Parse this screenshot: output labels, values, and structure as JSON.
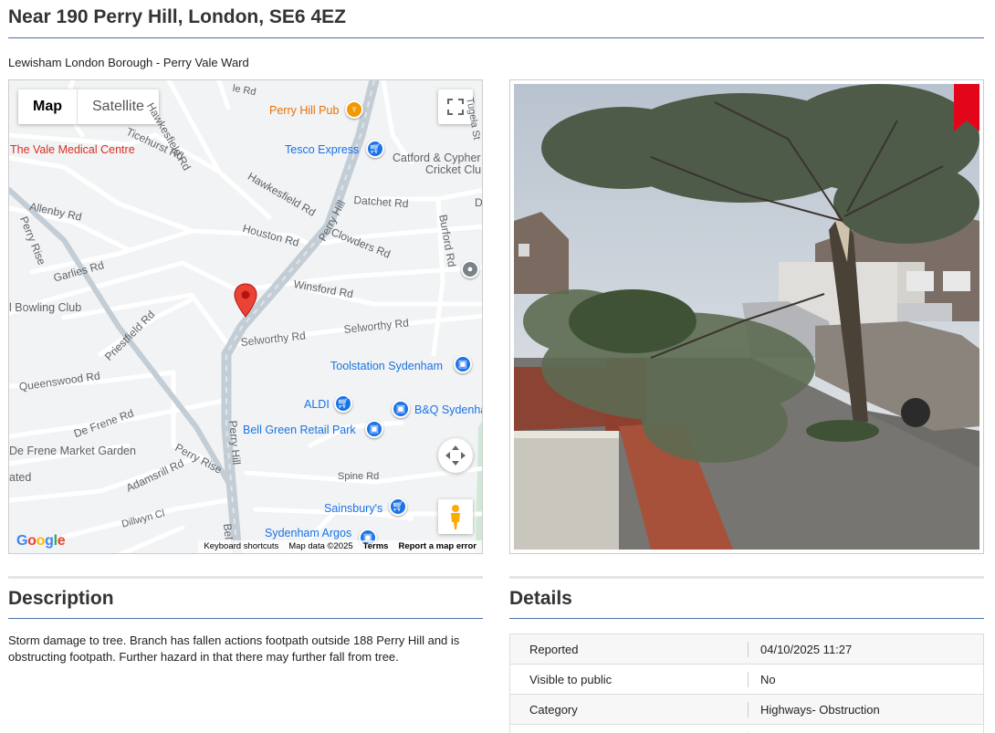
{
  "page": {
    "title": "Near 190 Perry Hill, London, SE6 4EZ",
    "ward": "Lewisham London Borough - Perry Vale Ward"
  },
  "map": {
    "type_map_label": "Map",
    "type_satellite_label": "Satellite",
    "streets": {
      "hawkesfield_top": "Hawkesfield Rd",
      "ticehurst": "Ticehurst Rd",
      "hawkesfield_mid": "Hawkesfield Rd",
      "allenby": "Allenby Rd",
      "perry_rise_left": "Perry Rise",
      "garlies": "Garlies Rd",
      "houston": "Houston Rd",
      "perry_hill_diag": "Perry Hill",
      "clowders": "Clowders Rd",
      "datchet": "Datchet Rd",
      "burford": "Burford Rd",
      "winsford": "Winsford Rd",
      "selworthy_left": "Selworthy Rd",
      "selworthy_right": "Selworthy Rd",
      "priestfield": "Priestfield Rd",
      "queenswood": "Queenswood Rd",
      "de_frene": "De Frene Rd",
      "perry_rise_bottom": "Perry Rise",
      "adamsrill": "Adamsrill Rd",
      "perry_hill_vert": "Perry Hill",
      "spine": "Spine Rd",
      "dillwyn": "Dillwyn Cl",
      "tugela": "Tugela St",
      "top_rd": "le Rd",
      "right_d": "D",
      "bel": "Bel"
    },
    "places": {
      "perry_hill_pub": "Perry Hill Pub",
      "vale_medical": "The Vale Medical Centre",
      "tesco": "Tesco Express",
      "catford_cypher_1": "Catford & Cypher",
      "catford_cypher_2": "Cricket Clu",
      "bowling": "l Bowling Club",
      "toolstation": "Toolstation Sydenham",
      "aldi": "ALDI",
      "bq": "B&Q Sydenha",
      "bell_green": "Bell Green Retail Park",
      "de_frene_market": "De Frene Market Garden",
      "ated": "ated",
      "sainsburys": "Sainsbury's",
      "sydenham_argos": "Sydenham Argos"
    },
    "google_logo": "Google",
    "attribution": {
      "keyboard": "Keyboard shortcuts",
      "data": "Map data ©2025",
      "terms": "Terms",
      "report": "Report a map error"
    },
    "icons": {
      "fullscreen": "fullscreen-icon",
      "move": "move-icon",
      "pegman": "pegman-icon",
      "marker": "map-marker-icon"
    },
    "colors": {
      "marker": "#ea4335",
      "poi_blue": "#1a73e8",
      "poi_orange": "#f29900"
    }
  },
  "photo": {
    "bookmark_color": "#e3061a"
  },
  "description": {
    "heading": "Description",
    "text": "Storm damage to tree. Branch has fallen actions footpath outside 188 Perry Hill and is obstructing footpath. Further hazard in that there may further fall from tree."
  },
  "details": {
    "heading": "Details",
    "rows": [
      {
        "key": "Reported",
        "value": "04/10/2025 11:27"
      },
      {
        "key": "Visible to public",
        "value": "No"
      },
      {
        "key": "Category",
        "value": "Highways- Obstruction"
      }
    ]
  }
}
